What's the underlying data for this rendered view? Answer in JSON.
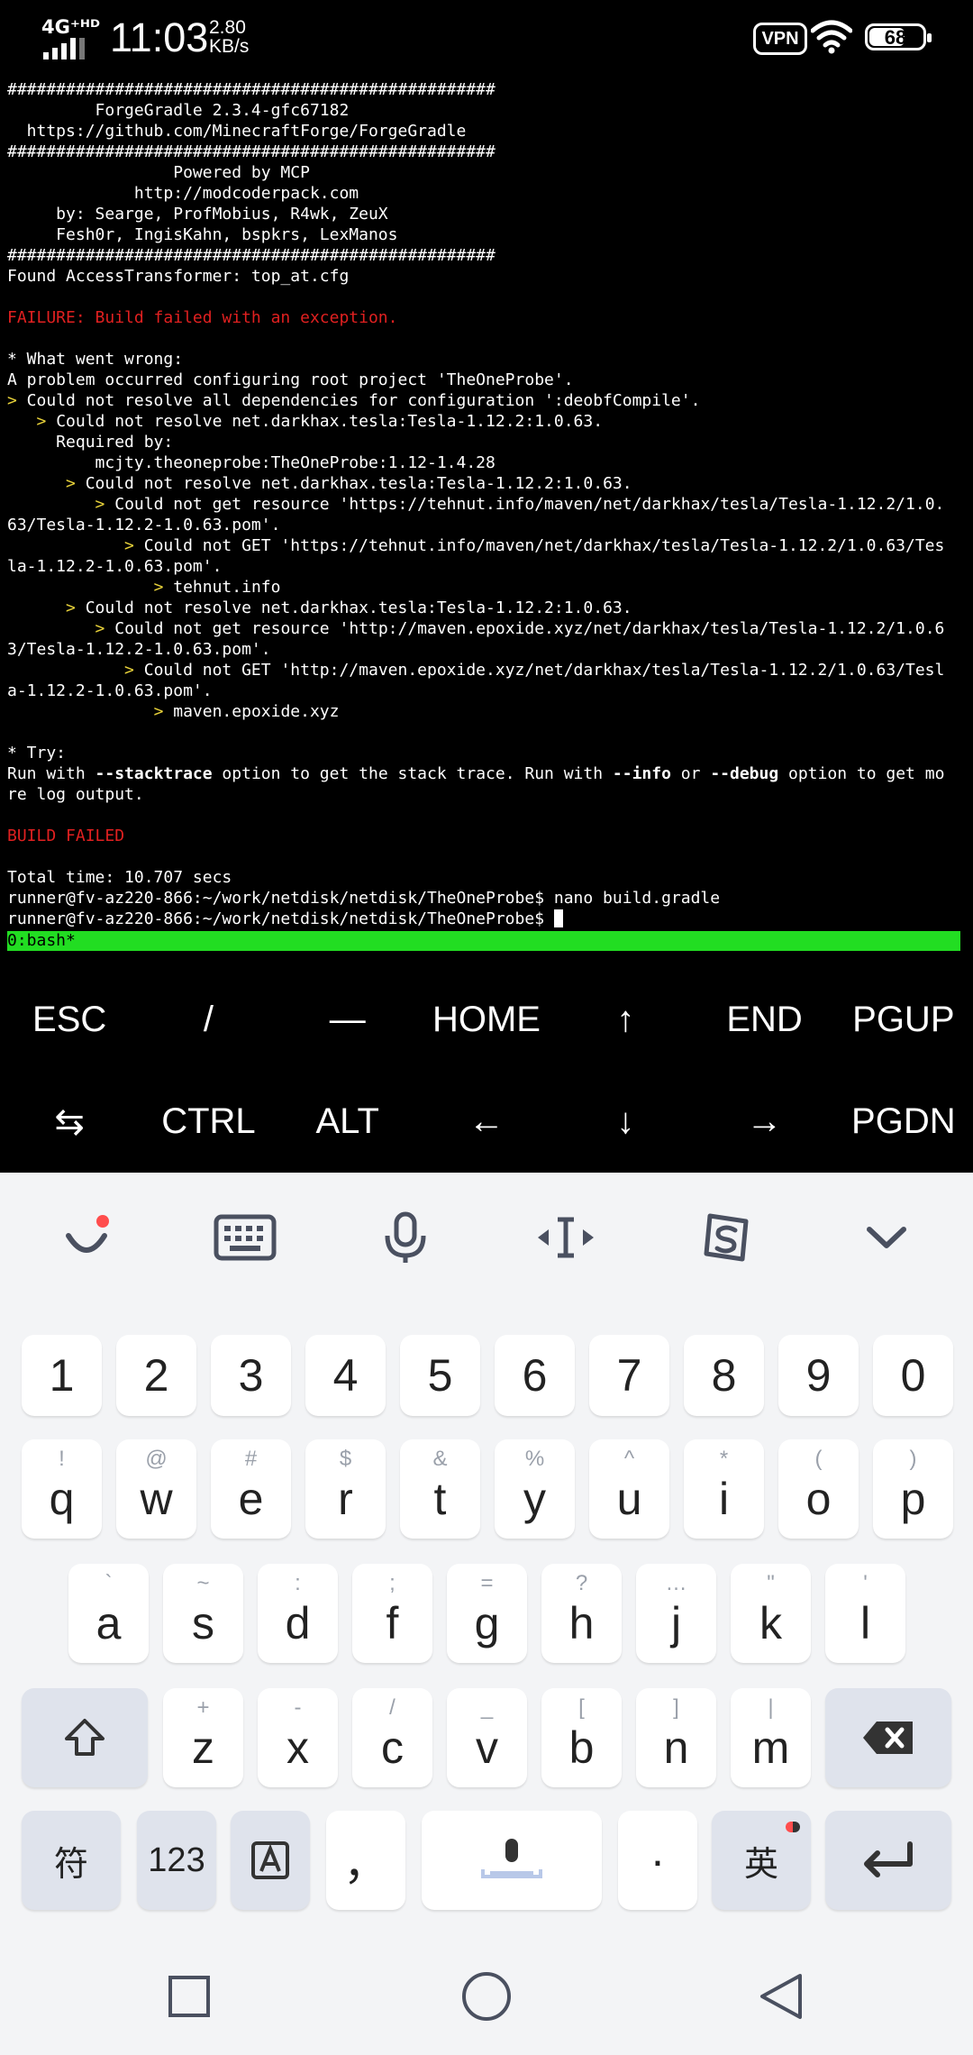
{
  "status_bar": {
    "network_tag": "4G⁺ᴴᴰ",
    "time": "11:03",
    "speed_value": "2.80",
    "speed_unit": "KB/s",
    "vpn": "VPN",
    "battery": "68",
    "battery_level_percent": 68
  },
  "terminal": {
    "lines": [
      "##################################################",
      "         ForgeGradle 2.3.4-gfc67182",
      "  https://github.com/MinecraftForge/ForgeGradle",
      "##################################################",
      "                 Powered by MCP",
      "             http://modcoderpack.com",
      "     by: Searge, ProfMobius, R4wk, ZeuX",
      "     Fesh0r, IngisKahn, bspkrs, LexManos",
      "##################################################",
      "Found AccessTransformer: top_at.cfg",
      "",
      "FAILURE: Build failed with an exception.",
      "",
      "* What went wrong:",
      "A problem occurred configuring root project 'TheOneProbe'.",
      "> Could not resolve all dependencies for configuration ':deobfCompile'.",
      "   > Could not resolve net.darkhax.tesla:Tesla-1.12.2:1.0.63.",
      "     Required by:",
      "         mcjty.theoneprobe:TheOneProbe:1.12-1.4.28",
      "      > Could not resolve net.darkhax.tesla:Tesla-1.12.2:1.0.63.",
      "         > Could not get resource 'https://tehnut.info/maven/net/darkhax/tesla/Tesla-1.12.2/1.0.",
      "63/Tesla-1.12.2-1.0.63.pom'.",
      "            > Could not GET 'https://tehnut.info/maven/net/darkhax/tesla/Tesla-1.12.2/1.0.63/Tes",
      "la-1.12.2-1.0.63.pom'.",
      "               > tehnut.info",
      "      > Could not resolve net.darkhax.tesla:Tesla-1.12.2:1.0.63.",
      "         > Could not get resource 'http://maven.epoxide.xyz/net/darkhax/tesla/Tesla-1.12.2/1.0.6",
      "3/Tesla-1.12.2-1.0.63.pom'.",
      "            > Could not GET 'http://maven.epoxide.xyz/net/darkhax/tesla/Tesla-1.12.2/1.0.63/Tesl",
      "a-1.12.2-1.0.63.pom'.",
      "               > maven.epoxide.xyz",
      "",
      "* Try:",
      "Run with --stacktrace option to get the stack trace. Run with --info or --debug option to get mo",
      "re log output.",
      "",
      "BUILD FAILED",
      "",
      "Total time: 10.707 secs",
      "runner@fv-az220-866:~/work/netdisk/netdisk/TheOneProbe$ nano build.gradle",
      "runner@fv-az220-866:~/work/netdisk/netdisk/TheOneProbe$ "
    ],
    "red_lines": [
      11,
      36
    ],
    "tmux_status": "0:bash*"
  },
  "extra_keys": {
    "row1": [
      "ESC",
      "/",
      "—",
      "HOME",
      "↑",
      "END",
      "PGUP"
    ],
    "row2": [
      "⇆",
      "CTRL",
      "ALT",
      "←",
      "↓",
      "→",
      "PGDN"
    ]
  },
  "keyboard": {
    "toolbar_icons": [
      "emoji-icon",
      "keyboard-icon",
      "microphone-icon",
      "cursor-move-icon",
      "sogou-logo-icon",
      "collapse-icon"
    ],
    "numbers": [
      "1",
      "2",
      "3",
      "4",
      "5",
      "6",
      "7",
      "8",
      "9",
      "0"
    ],
    "row_q": [
      {
        "main": "q",
        "sub": "!"
      },
      {
        "main": "w",
        "sub": "@"
      },
      {
        "main": "e",
        "sub": "#"
      },
      {
        "main": "r",
        "sub": "$"
      },
      {
        "main": "t",
        "sub": "&"
      },
      {
        "main": "y",
        "sub": "%"
      },
      {
        "main": "u",
        "sub": "^"
      },
      {
        "main": "i",
        "sub": "*"
      },
      {
        "main": "o",
        "sub": "("
      },
      {
        "main": "p",
        "sub": ")"
      }
    ],
    "row_a": [
      {
        "main": "a",
        "sub": "`"
      },
      {
        "main": "s",
        "sub": "~"
      },
      {
        "main": "d",
        "sub": ":"
      },
      {
        "main": "f",
        "sub": ";"
      },
      {
        "main": "g",
        "sub": "="
      },
      {
        "main": "h",
        "sub": "?"
      },
      {
        "main": "j",
        "sub": "…"
      },
      {
        "main": "k",
        "sub": "\""
      },
      {
        "main": "l",
        "sub": "'"
      }
    ],
    "row_z": [
      {
        "main": "z",
        "sub": "+"
      },
      {
        "main": "x",
        "sub": "-"
      },
      {
        "main": "c",
        "sub": "/"
      },
      {
        "main": "v",
        "sub": "_"
      },
      {
        "main": "b",
        "sub": "["
      },
      {
        "main": "n",
        "sub": "]"
      },
      {
        "main": "m",
        "sub": "|"
      }
    ],
    "bottom": {
      "symbols": "符",
      "num123": "123",
      "comma": "，",
      "period": "·",
      "lang": "英"
    }
  }
}
